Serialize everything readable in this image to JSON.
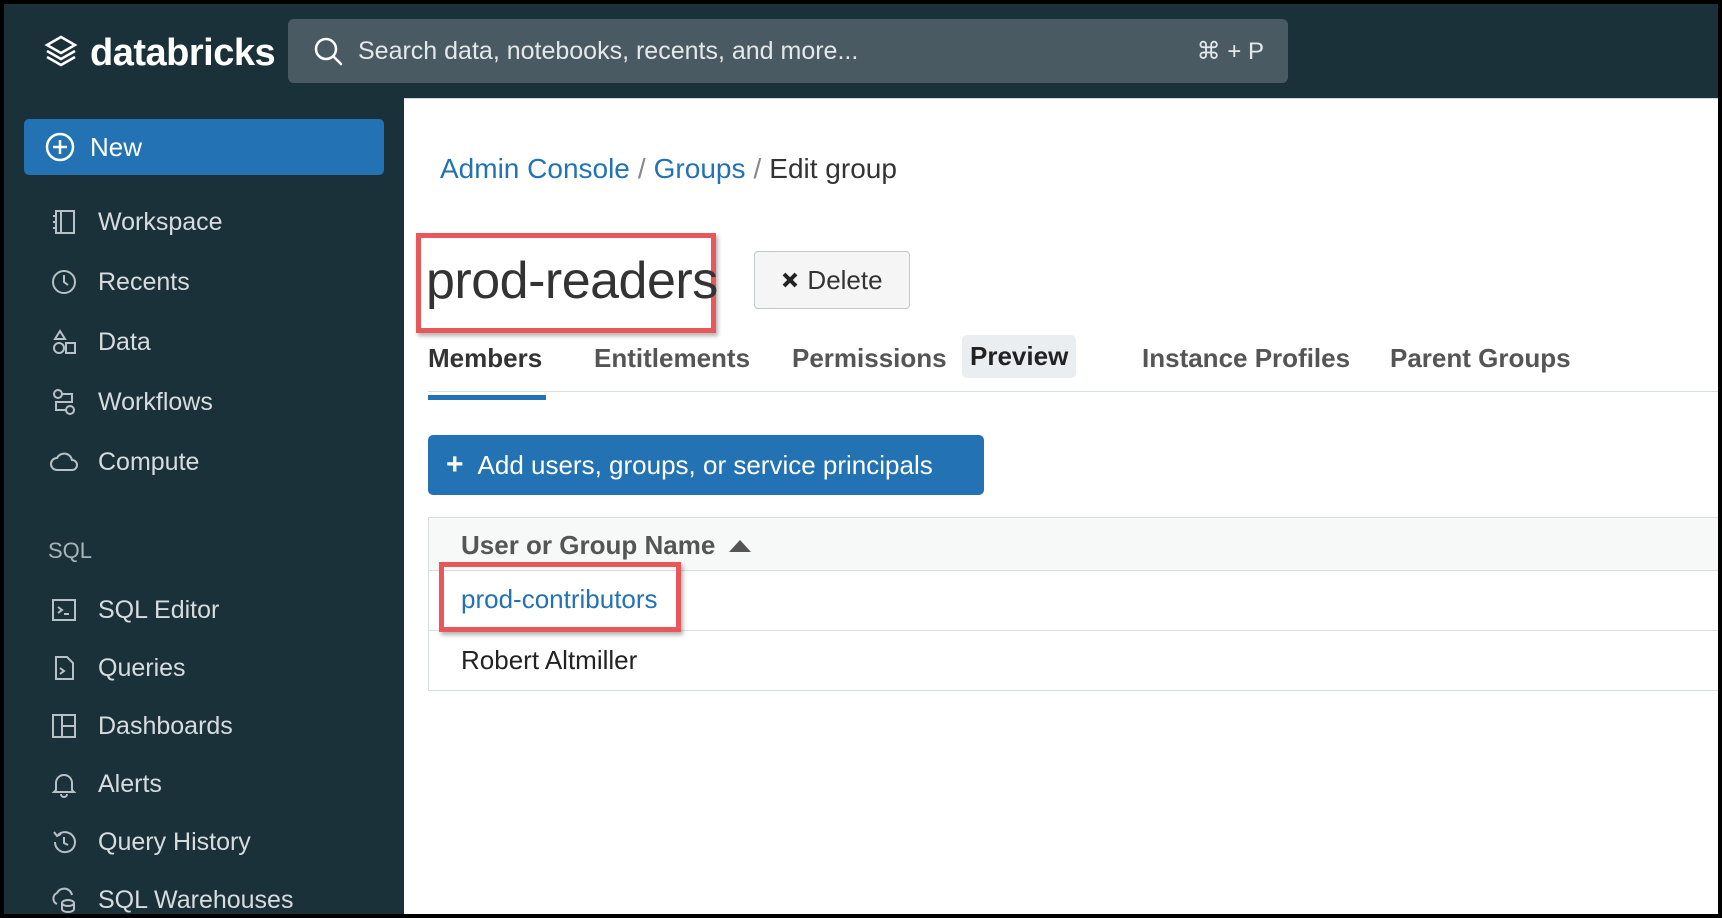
{
  "app": {
    "logo_text": "databricks"
  },
  "search": {
    "placeholder": "Search data, notebooks, recents, and more...",
    "shortcut": "⌘ + P"
  },
  "sidebar": {
    "new_label": "New",
    "items": [
      {
        "label": "Workspace",
        "icon": "workspace-icon"
      },
      {
        "label": "Recents",
        "icon": "clock-icon"
      },
      {
        "label": "Data",
        "icon": "data-icon"
      },
      {
        "label": "Workflows",
        "icon": "workflows-icon"
      },
      {
        "label": "Compute",
        "icon": "cloud-icon"
      }
    ],
    "sql_section_label": "SQL",
    "sql_items": [
      {
        "label": "SQL Editor",
        "icon": "sql-editor-icon"
      },
      {
        "label": "Queries",
        "icon": "queries-icon"
      },
      {
        "label": "Dashboards",
        "icon": "dashboard-icon"
      },
      {
        "label": "Alerts",
        "icon": "bell-icon"
      },
      {
        "label": "Query History",
        "icon": "history-icon"
      },
      {
        "label": "SQL Warehouses",
        "icon": "warehouse-icon"
      }
    ]
  },
  "breadcrumb": {
    "items": [
      "Admin Console",
      "Groups",
      "Edit group"
    ],
    "separator": "/"
  },
  "group": {
    "name": "prod-readers",
    "delete_label": "Delete"
  },
  "tabs": [
    {
      "label": "Members",
      "active": true
    },
    {
      "label": "Entitlements"
    },
    {
      "label": "Permissions",
      "badge": "Preview"
    },
    {
      "label": "Instance Profiles"
    },
    {
      "label": "Parent Groups"
    }
  ],
  "add_button": {
    "label": "Add users, groups, or service principals"
  },
  "table": {
    "column_header": "User or Group Name",
    "rows": [
      {
        "name": "prod-contributors",
        "is_link": true
      },
      {
        "name": "Robert Altmiller",
        "is_link": false
      }
    ]
  },
  "colors": {
    "accent": "#2272b4",
    "sidebar_bg": "#1b3139",
    "highlight": "#e8575a"
  }
}
